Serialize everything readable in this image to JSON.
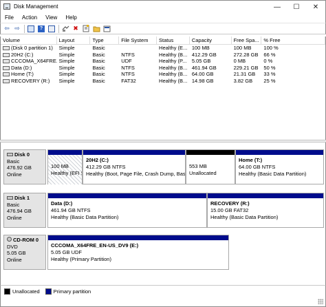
{
  "window": {
    "title": "Disk Management",
    "minimize_glyph": "—",
    "maximize_glyph": "☐",
    "close_glyph": "✕"
  },
  "menu": [
    "File",
    "Action",
    "View",
    "Help"
  ],
  "toolbar": {
    "icons": [
      "back-arrow-icon",
      "forward-arrow-icon",
      "show-hide-tree-icon",
      "help-icon",
      "console-help-icon",
      "connect-drive-icon",
      "delete-icon",
      "properties-icon",
      "folder-icon",
      "view-icon"
    ],
    "back_glyph": "⇦",
    "forward_glyph": "⇨",
    "help_glyph": "?",
    "delete_glyph": "✖"
  },
  "volume_list": {
    "columns": [
      "Volume",
      "Layout",
      "Type",
      "File System",
      "Status",
      "Capacity",
      "Free Spa...",
      "% Free"
    ],
    "rows": [
      [
        "(Disk 0 partition 1)",
        "Simple",
        "Basic",
        "",
        "Healthy (E...",
        "100 MB",
        "100 MB",
        "100 %"
      ],
      [
        "20H2 (C:)",
        "Simple",
        "Basic",
        "NTFS",
        "Healthy (B...",
        "412.29 GB",
        "272.28 GB",
        "66 %"
      ],
      [
        "CCCOMA_X64FRE...",
        "Simple",
        "Basic",
        "UDF",
        "Healthy (P...",
        "5.05 GB",
        "0 MB",
        "0 %"
      ],
      [
        "Data (D:)",
        "Simple",
        "Basic",
        "NTFS",
        "Healthy (B...",
        "461.94 GB",
        "229.21 GB",
        "50 %"
      ],
      [
        "Home (T:)",
        "Simple",
        "Basic",
        "NTFS",
        "Healthy (B...",
        "64.00 GB",
        "21.31 GB",
        "33 %"
      ],
      [
        "RECOVERY (R:)",
        "Simple",
        "Basic",
        "FAT32",
        "Healthy (B...",
        "14.98 GB",
        "3.82 GB",
        "25 %"
      ]
    ]
  },
  "disks": [
    {
      "name": "Disk 0",
      "type": "Basic",
      "size": "476.92 GB",
      "status": "Online",
      "partitions": [
        {
          "name": "",
          "size": "100 MB",
          "status": "Healthy (EFI System",
          "kind": "primary",
          "selected": true
        },
        {
          "name": "20H2  (C:)",
          "size": "412.29 GB NTFS",
          "status": "Healthy (Boot, Page File, Crash Dump, Bas",
          "kind": "primary",
          "selected": false
        },
        {
          "name": "",
          "size": "553 MB",
          "status": "Unallocated",
          "kind": "unallocated",
          "selected": false
        },
        {
          "name": "Home  (T:)",
          "size": "64.00 GB NTFS",
          "status": "Healthy (Basic Data Partition)",
          "kind": "primary",
          "selected": false
        }
      ]
    },
    {
      "name": "Disk 1",
      "type": "Basic",
      "size": "476.94 GB",
      "status": "Online",
      "partitions": [
        {
          "name": "Data  (D:)",
          "size": "461.94 GB NTFS",
          "status": "Healthy (Basic Data Partition)",
          "kind": "primary",
          "selected": false
        },
        {
          "name": "RECOVERY  (R:)",
          "size": "15.00 GB FAT32",
          "status": "Healthy (Basic Data Partition)",
          "kind": "primary",
          "selected": false
        }
      ]
    },
    {
      "name": "CD-ROM 0",
      "type": "DVD",
      "size": "5.05 GB",
      "status": "Online",
      "partitions": [
        {
          "name": "CCCOMA_X64FRE_EN-US_DV9  (E:)",
          "size": "5.05 GB UDF",
          "status": "Healthy (Primary Partition)",
          "kind": "primary",
          "selected": false
        }
      ]
    }
  ],
  "legend": {
    "items": [
      {
        "label": "Unallocated",
        "color": "#000000"
      },
      {
        "label": "Primary partition",
        "color": "#000c8c"
      }
    ]
  }
}
